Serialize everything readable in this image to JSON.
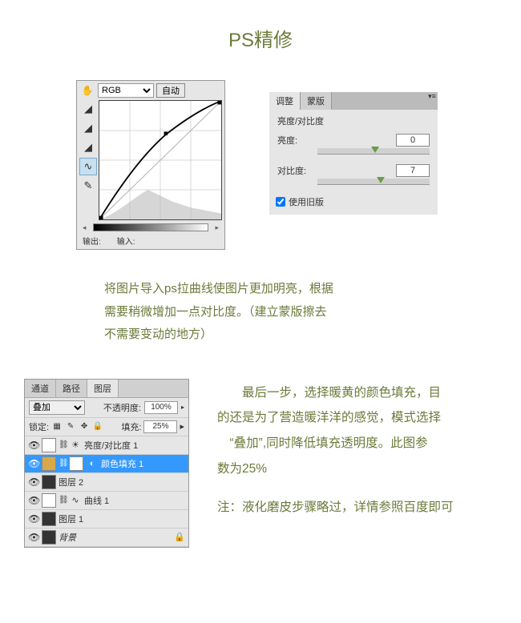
{
  "title": "PS精修",
  "curves": {
    "hand_icon": "✋",
    "channel": "RGB",
    "auto": "自动",
    "eyedroppers": [
      "◢",
      "◢",
      "◢"
    ],
    "tools": [
      "∿",
      "✎"
    ],
    "output_label": "输出:",
    "input_label": "输入:"
  },
  "bc": {
    "tab1": "调整",
    "tab2": "蒙版",
    "title": "亮度/对比度",
    "brightness_label": "亮度:",
    "brightness_value": "0",
    "contrast_label": "对比度:",
    "contrast_value": "7",
    "legacy": "使用旧版"
  },
  "para1_l1": "将图片导入ps拉曲线使图片更加明亮，根据",
  "para1_l2": "需要稍微增加一点对比度。（建立蒙版擦去",
  "para1_l3": "不需要变动的地方）",
  "layers": {
    "tab1": "通道",
    "tab2": "路径",
    "tab3": "图层",
    "blend": "叠加",
    "opacity_label": "不透明度:",
    "opacity_value": "100%",
    "lock_label": "锁定:",
    "fill_label": "填充:",
    "fill_value": "25%",
    "items": [
      {
        "eye": "👁",
        "name": "亮度/对比度 1",
        "adj": "☀",
        "mask": true
      },
      {
        "eye": "👁",
        "name": "颜色填充  1",
        "color": "orange",
        "mask": true,
        "sel": true
      },
      {
        "eye": "👁",
        "name": "图层 2",
        "simple": true
      },
      {
        "eye": "👁",
        "name": "曲线 1",
        "adj": "∿",
        "mask": true
      },
      {
        "eye": "👁",
        "name": "图层 1",
        "simple": true
      },
      {
        "eye": "👁",
        "name": "背景",
        "bg": true,
        "lock": "🔒"
      }
    ]
  },
  "para2_l1": "　　最后一步，选择暖黄的颜色填充，目",
  "para2_l2": "的还是为了营造暖洋洋的感觉，模式选择",
  "para2_l3": "　“叠加”,同时降低填充透明度。此图参",
  "para2_l4": "数为25%",
  "para2_note": "注：液化磨皮步骤略过，详情参照百度即可"
}
